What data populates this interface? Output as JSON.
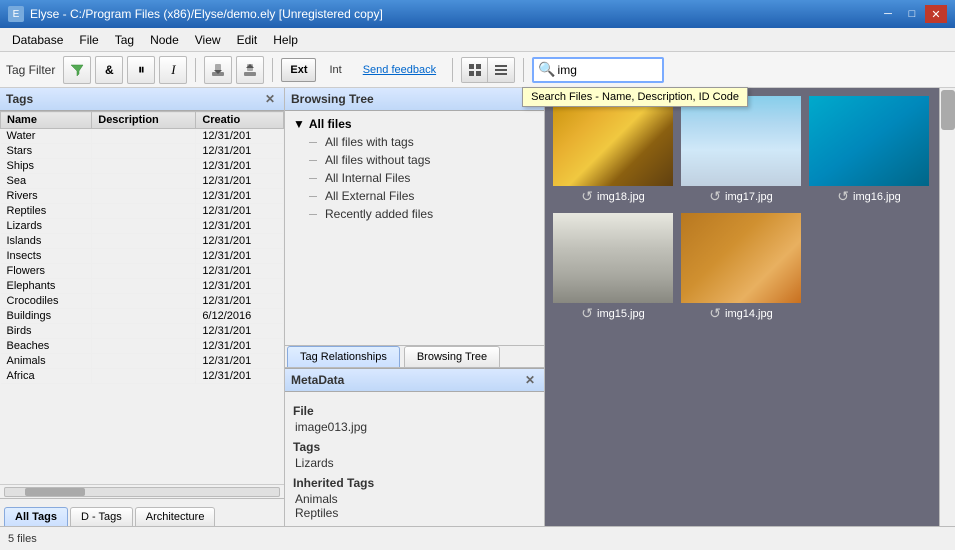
{
  "titleBar": {
    "title": "Elyse - C:/Program Files (x86)/Elyse/demo.ely [Unregistered copy]",
    "icon": "E",
    "minimize": "─",
    "maximize": "□",
    "close": "✕"
  },
  "menuBar": {
    "items": [
      "Database",
      "File",
      "Tag",
      "Node",
      "View",
      "Edit",
      "Help"
    ]
  },
  "toolbar": {
    "tagFilterLabel": "Tag Filter",
    "extLabel": "Ext",
    "intLabel": "Int",
    "sendFeedback": "Send feedback",
    "searchValue": "img",
    "searchPlaceholder": "Search Files - Name, Description, ID Code"
  },
  "tagsPanel": {
    "title": "Tags",
    "columns": [
      "Name",
      "Description",
      "Creation"
    ],
    "rows": [
      {
        "name": "Water",
        "description": "",
        "creation": "12/31/201"
      },
      {
        "name": "Stars",
        "description": "",
        "creation": "12/31/201"
      },
      {
        "name": "Ships",
        "description": "",
        "creation": "12/31/201"
      },
      {
        "name": "Sea",
        "description": "",
        "creation": "12/31/201"
      },
      {
        "name": "Rivers",
        "description": "",
        "creation": "12/31/201"
      },
      {
        "name": "Reptiles",
        "description": "",
        "creation": "12/31/201"
      },
      {
        "name": "Lizards",
        "description": "",
        "creation": "12/31/201"
      },
      {
        "name": "Islands",
        "description": "",
        "creation": "12/31/201"
      },
      {
        "name": "Insects",
        "description": "",
        "creation": "12/31/201"
      },
      {
        "name": "Flowers",
        "description": "",
        "creation": "12/31/201"
      },
      {
        "name": "Elephants",
        "description": "",
        "creation": "12/31/201"
      },
      {
        "name": "Crocodiles",
        "description": "",
        "creation": "12/31/201"
      },
      {
        "name": "Buildings",
        "description": "",
        "creation": "6/12/2016"
      },
      {
        "name": "Birds",
        "description": "",
        "creation": "12/31/201"
      },
      {
        "name": "Beaches",
        "description": "",
        "creation": "12/31/201"
      },
      {
        "name": "Animals",
        "description": "",
        "creation": "12/31/201"
      },
      {
        "name": "Africa",
        "description": "",
        "creation": "12/31/201"
      }
    ],
    "tabs": [
      "All Tags",
      "D - Tags",
      "Architecture"
    ]
  },
  "browsingTree": {
    "title": "Browsing Tree",
    "root": "All files",
    "items": [
      "All files with tags",
      "All files without tags",
      "All Internal Files",
      "All External Files",
      "Recently added files"
    ],
    "tabs": [
      "Tag Relationships",
      "Browsing Tree"
    ]
  },
  "metaPanel": {
    "title": "MetaData",
    "fileLabel": "File",
    "fileName": "image013.jpg",
    "tagsLabel": "Tags",
    "tagValue": "Lizards",
    "inheritedTagsLabel": "Inherited Tags",
    "inheritedTag1": "Animals",
    "inheritedTag2": "Reptiles"
  },
  "images": [
    {
      "name": "img18.jpg",
      "class": "img-arch1"
    },
    {
      "name": "img17.jpg",
      "class": "img-arch2"
    },
    {
      "name": "img16.jpg",
      "class": "img-arch3"
    },
    {
      "name": "img15.jpg",
      "class": "img-arch4"
    },
    {
      "name": "img14.jpg",
      "class": "img-arch5"
    }
  ],
  "statusBar": {
    "text": "5 files"
  }
}
